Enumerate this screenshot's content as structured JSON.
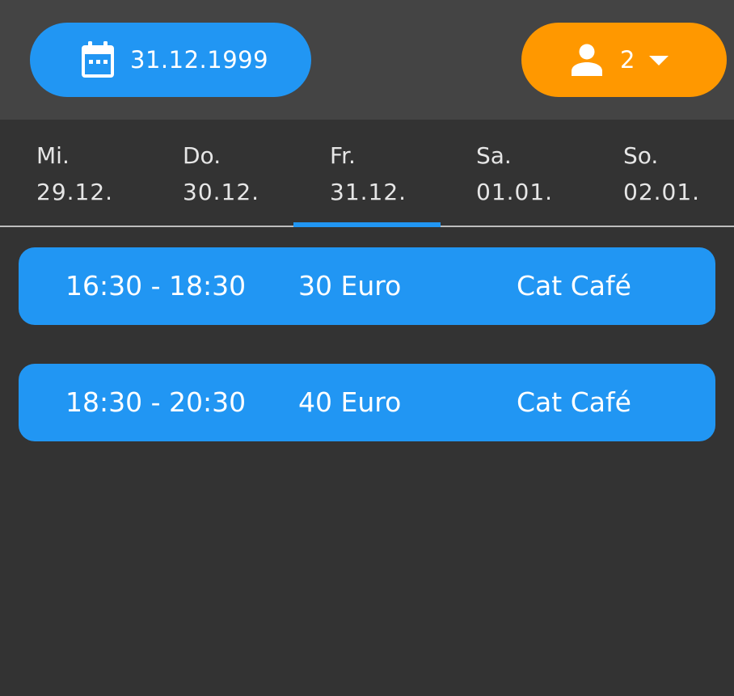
{
  "header": {
    "date": "31.12.1999",
    "guests": "2"
  },
  "days": [
    {
      "weekday": "Mi.",
      "date": "29.12."
    },
    {
      "weekday": "Do.",
      "date": "30.12."
    },
    {
      "weekday": "Fr.",
      "date": "31.12."
    },
    {
      "weekday": "Sa.",
      "date": "01.01."
    },
    {
      "weekday": "So.",
      "date": "02.01."
    }
  ],
  "slots": [
    {
      "time": "16:30 - 18:30",
      "price": "30 Euro",
      "venue": "Cat Café"
    },
    {
      "time": "18:30 - 20:30",
      "price": "40 Euro",
      "venue": "Cat Café"
    }
  ],
  "colors": {
    "accent": "#2196F3",
    "guest_button": "#FF9800",
    "background": "#333333",
    "topbar": "#444444"
  },
  "icons": {
    "date_button": "calendar-icon",
    "guest_button": "person-icon",
    "guest_dropdown": "chevron-down-icon"
  }
}
